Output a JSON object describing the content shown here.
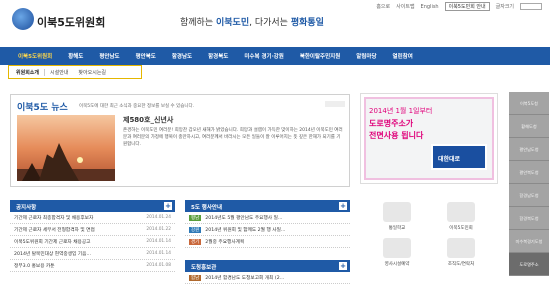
{
  "header": {
    "site_name": "이북5도위원회",
    "slogan_pre": "함께하는 ",
    "slogan_b1": "이북도민",
    "slogan_mid": ", 다가서는 ",
    "slogan_b2": "평화통일"
  },
  "util": [
    "홈으로",
    "사이트맵",
    "English",
    "제한영역안내",
    "이북5도민회 안내",
    "글자크기"
  ],
  "nav": [
    {
      "label": "이북5도위원회",
      "active": true
    },
    {
      "label": "황해도"
    },
    {
      "label": "평안남도"
    },
    {
      "label": "평안북도"
    },
    {
      "label": "함경남도"
    },
    {
      "label": "함경북도"
    },
    {
      "label": "미수복 경기·강원"
    },
    {
      "label": "북한이탈주민지원"
    },
    {
      "label": "알림마당"
    },
    {
      "label": "열린참여"
    }
  ],
  "subnav": [
    "위원회소개",
    "시설안내",
    "찾아오시는길"
  ],
  "news": {
    "title": "이북5도 뉴스",
    "subtitle": "이북5도에 대한 최근 소식과 중요한 정보를 보실 수 있습니다.",
    "heading": "제580호_신년사",
    "body": "존경하는 이북도민 여러분! 희망찬 갑오년 새해가 밝았습니다. 희망과 설렘이 가득한 맞이하는 2014년 이북도민 여러분과 여러분의 가정에 행복이 충만하시고, 여러분께서 바라시는 모든 일들이 잘 이루어지는 뜻 깊은 한해가 되기를 기원합니다."
  },
  "banner": {
    "l1": "2014년 1월 1일부터",
    "l2": "도로명주소가",
    "l3": "전면사용 됩니다",
    "sign": "대한대로"
  },
  "sidebar": [
    "이북5도청",
    "황해도청",
    "평안남도청",
    "평안북도청",
    "함경남도청",
    "함경북도청",
    "미수복경기도청",
    "미수복강원도청",
    "도로명주소"
  ],
  "notice": {
    "title": "공지사항",
    "items": [
      {
        "t": "기간제 근로자 최종합격자 및 채용후보자",
        "d": "2014.01.24"
      },
      {
        "t": "기간제 근로자 세무서 전형합격자 및 면접",
        "d": "2014.01.22"
      },
      {
        "t": "이북5도위원회 기간제 근로자 채용공고",
        "d": "2014.01.14"
      },
      {
        "t": "2014년 탈북민대상 현역중생입 기음...",
        "d": "2014.01.14"
      },
      {
        "t": "정부3.0 홍보용 카툰",
        "d": "2014.01.08"
      }
    ]
  },
  "event": {
    "title": "5도 행사안내",
    "items": [
      {
        "tag": "평남",
        "color": "#5a9e3a",
        "t": "2014년도 5월 평안남도 주요행사 일..."
      },
      {
        "tag": "강원",
        "color": "#2e7ab8",
        "t": "2014년 위원회 및 함께도 2월 행 사일..."
      },
      {
        "tag": "경기",
        "color": "#c9683b",
        "t": "2월중 주요행사계획"
      }
    ]
  },
  "newsletter": {
    "title": "도청홍보관",
    "items": [
      {
        "tag": "함남",
        "color": "#b0692e",
        "t": "2014년 함경남도 도청보고회 개최 (2..."
      }
    ]
  },
  "quick": [
    "통일학교",
    "이북5도민회",
    "영사시설예약",
    "조직도/연락처",
    "",
    ""
  ]
}
